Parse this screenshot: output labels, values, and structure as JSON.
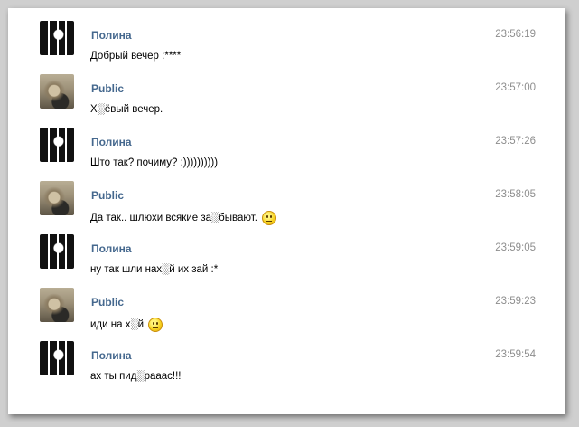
{
  "messages": [
    {
      "author": "Полина",
      "avatar": "polina-avatar",
      "text": "Добрый вечер :****",
      "time": "23:56:19",
      "emoji": false
    },
    {
      "author": "Public",
      "avatar": "public-avatar",
      "text": "Х░ёвый вечер.",
      "time": "23:57:00",
      "emoji": false
    },
    {
      "author": "Полина",
      "avatar": "polina-avatar",
      "text": "Што так? почиму? :))))))))))",
      "time": "23:57:26",
      "emoji": false
    },
    {
      "author": "Public",
      "avatar": "public-avatar",
      "text": "Да так.. шлюхи всякие за░бывают.",
      "time": "23:58:05",
      "emoji": true
    },
    {
      "author": "Полина",
      "avatar": "polina-avatar",
      "text": "ну так шли нах░й их зай :*",
      "time": "23:59:05",
      "emoji": false
    },
    {
      "author": "Public",
      "avatar": "public-avatar",
      "text": "иди на х░й",
      "time": "23:59:23",
      "emoji": true
    },
    {
      "author": "Полина",
      "avatar": "polina-avatar",
      "text": "ах ты пид░раaас!!!",
      "time": "23:59:54",
      "emoji": false
    }
  ],
  "colors": {
    "author": "#45688e",
    "time": "#8e8e8e",
    "text": "#000000",
    "background": "#ffffff"
  }
}
